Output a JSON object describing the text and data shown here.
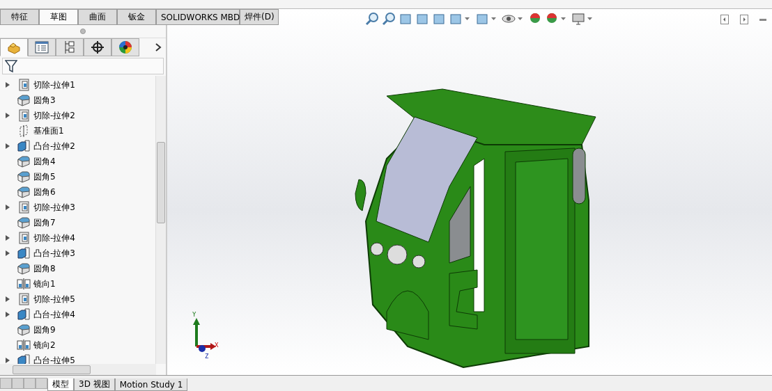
{
  "command_tabs": [
    {
      "label": "特征",
      "selected": false
    },
    {
      "label": "草图",
      "selected": true
    },
    {
      "label": "曲面",
      "selected": false
    },
    {
      "label": "钣金",
      "selected": false
    },
    {
      "label": "SOLIDWORKS MBD",
      "selected": false
    },
    {
      "label": "焊件(D)",
      "selected": false
    }
  ],
  "panel_tabs": [
    {
      "kind": "feature",
      "selected": true
    },
    {
      "kind": "property",
      "selected": false
    },
    {
      "kind": "config",
      "selected": false
    },
    {
      "kind": "dim",
      "selected": false
    },
    {
      "kind": "display",
      "selected": false
    }
  ],
  "feature_tree": [
    {
      "label": "切除-拉伸1",
      "kind": "cut",
      "expandable": true
    },
    {
      "label": "圆角3",
      "kind": "fillet",
      "expandable": false
    },
    {
      "label": "切除-拉伸2",
      "kind": "cut",
      "expandable": true
    },
    {
      "label": "基准面1",
      "kind": "plane",
      "expandable": false
    },
    {
      "label": "凸台-拉伸2",
      "kind": "boss",
      "expandable": true
    },
    {
      "label": "圆角4",
      "kind": "fillet",
      "expandable": false
    },
    {
      "label": "圆角5",
      "kind": "fillet",
      "expandable": false
    },
    {
      "label": "圆角6",
      "kind": "fillet",
      "expandable": false
    },
    {
      "label": "切除-拉伸3",
      "kind": "cut",
      "expandable": true
    },
    {
      "label": "圆角7",
      "kind": "fillet",
      "expandable": false
    },
    {
      "label": "切除-拉伸4",
      "kind": "cut",
      "expandable": true
    },
    {
      "label": "凸台-拉伸3",
      "kind": "boss",
      "expandable": true
    },
    {
      "label": "圆角8",
      "kind": "fillet",
      "expandable": false
    },
    {
      "label": "镜向1",
      "kind": "mirror",
      "expandable": false
    },
    {
      "label": "切除-拉伸5",
      "kind": "cut",
      "expandable": true
    },
    {
      "label": "凸台-拉伸4",
      "kind": "boss",
      "expandable": true
    },
    {
      "label": "圆角9",
      "kind": "fillet",
      "expandable": false
    },
    {
      "label": "镜向2",
      "kind": "mirror",
      "expandable": false
    },
    {
      "label": "凸台-拉伸5",
      "kind": "boss",
      "expandable": true
    }
  ],
  "triad": {
    "x": "X",
    "y": "Y",
    "z": "Z"
  },
  "bottom_tabs": [
    {
      "label": "模型",
      "selected": true
    },
    {
      "label": "3D 视图",
      "selected": false
    },
    {
      "label": "Motion Study 1",
      "selected": false
    }
  ]
}
